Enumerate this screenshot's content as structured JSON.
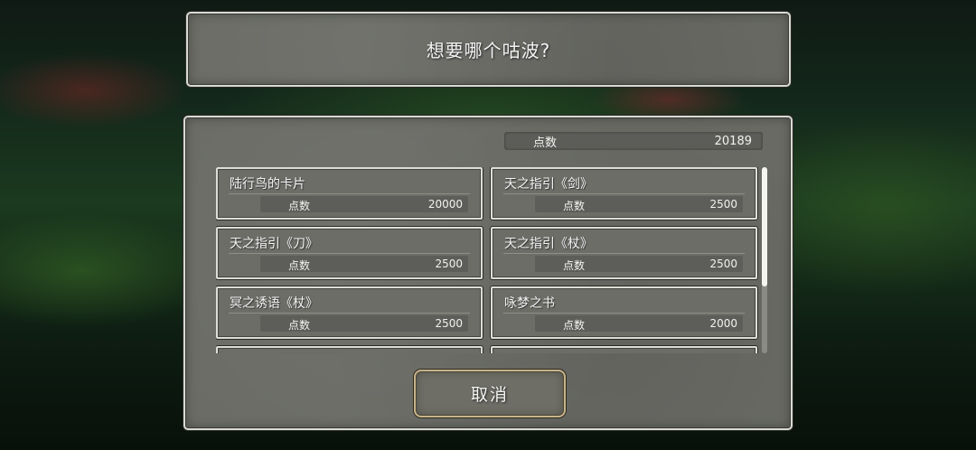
{
  "question": "想要哪个咕波?",
  "points": {
    "label": "点数",
    "value": "20189"
  },
  "items": [
    {
      "name": "陆行鸟的卡片",
      "cost_label": "点数",
      "cost": "20000"
    },
    {
      "name": "天之指引《剑》",
      "cost_label": "点数",
      "cost": "2500"
    },
    {
      "name": "天之指引《刀》",
      "cost_label": "点数",
      "cost": "2500"
    },
    {
      "name": "天之指引《杖》",
      "cost_label": "点数",
      "cost": "2500"
    },
    {
      "name": "冥之诱语《杖》",
      "cost_label": "点数",
      "cost": "2500"
    },
    {
      "name": "咏梦之书",
      "cost_label": "点数",
      "cost": "2000"
    },
    {
      "name": "",
      "cost_label": "",
      "cost": ""
    },
    {
      "name": "",
      "cost_label": "",
      "cost": ""
    }
  ],
  "cancel_label": "取消"
}
